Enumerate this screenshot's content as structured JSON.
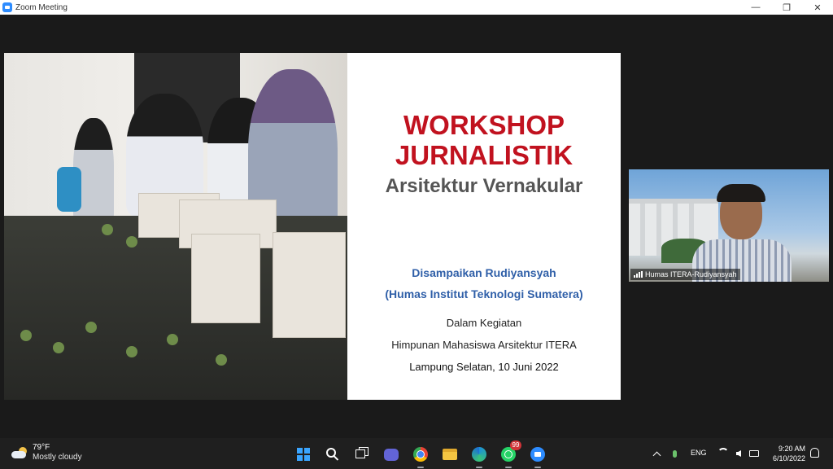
{
  "window": {
    "title": "Zoom Meeting",
    "minimize_glyph": "—",
    "maximize_glyph": "❐",
    "close_glyph": "✕"
  },
  "slide": {
    "line1": "WORKSHOP",
    "line2": "JURNALISTIK",
    "subtitle": "Arsitektur Vernakular",
    "presenter": "Disampaikan Rudiyansyah",
    "affiliation": "(Humas Institut Teknologi Sumatera)",
    "context_label": "Dalam Kegiatan",
    "organizer": "Himpunan Mahasiswa Arsitektur ITERA",
    "place_date": "Lampung Selatan, 10 Juni 2022",
    "title_color": "#c1121f",
    "presenter_color": "#2f5fa8"
  },
  "video": {
    "participant_name": "Humas ITERA-Rudiyansyah"
  },
  "taskbar": {
    "weather": {
      "temp": "79°F",
      "condition": "Mostly cloudy"
    },
    "apps": [
      {
        "name": "start-icon"
      },
      {
        "name": "search-icon"
      },
      {
        "name": "task-view-icon"
      },
      {
        "name": "chat-icon"
      },
      {
        "name": "chrome-icon"
      },
      {
        "name": "file-explorer-icon"
      },
      {
        "name": "edge-icon"
      },
      {
        "name": "whatsapp-icon",
        "badge": "99"
      },
      {
        "name": "zoom-icon"
      }
    ],
    "whatsapp_badge": "99",
    "language": "ENG",
    "time": "9:20 AM",
    "date": "6/10/2022"
  }
}
